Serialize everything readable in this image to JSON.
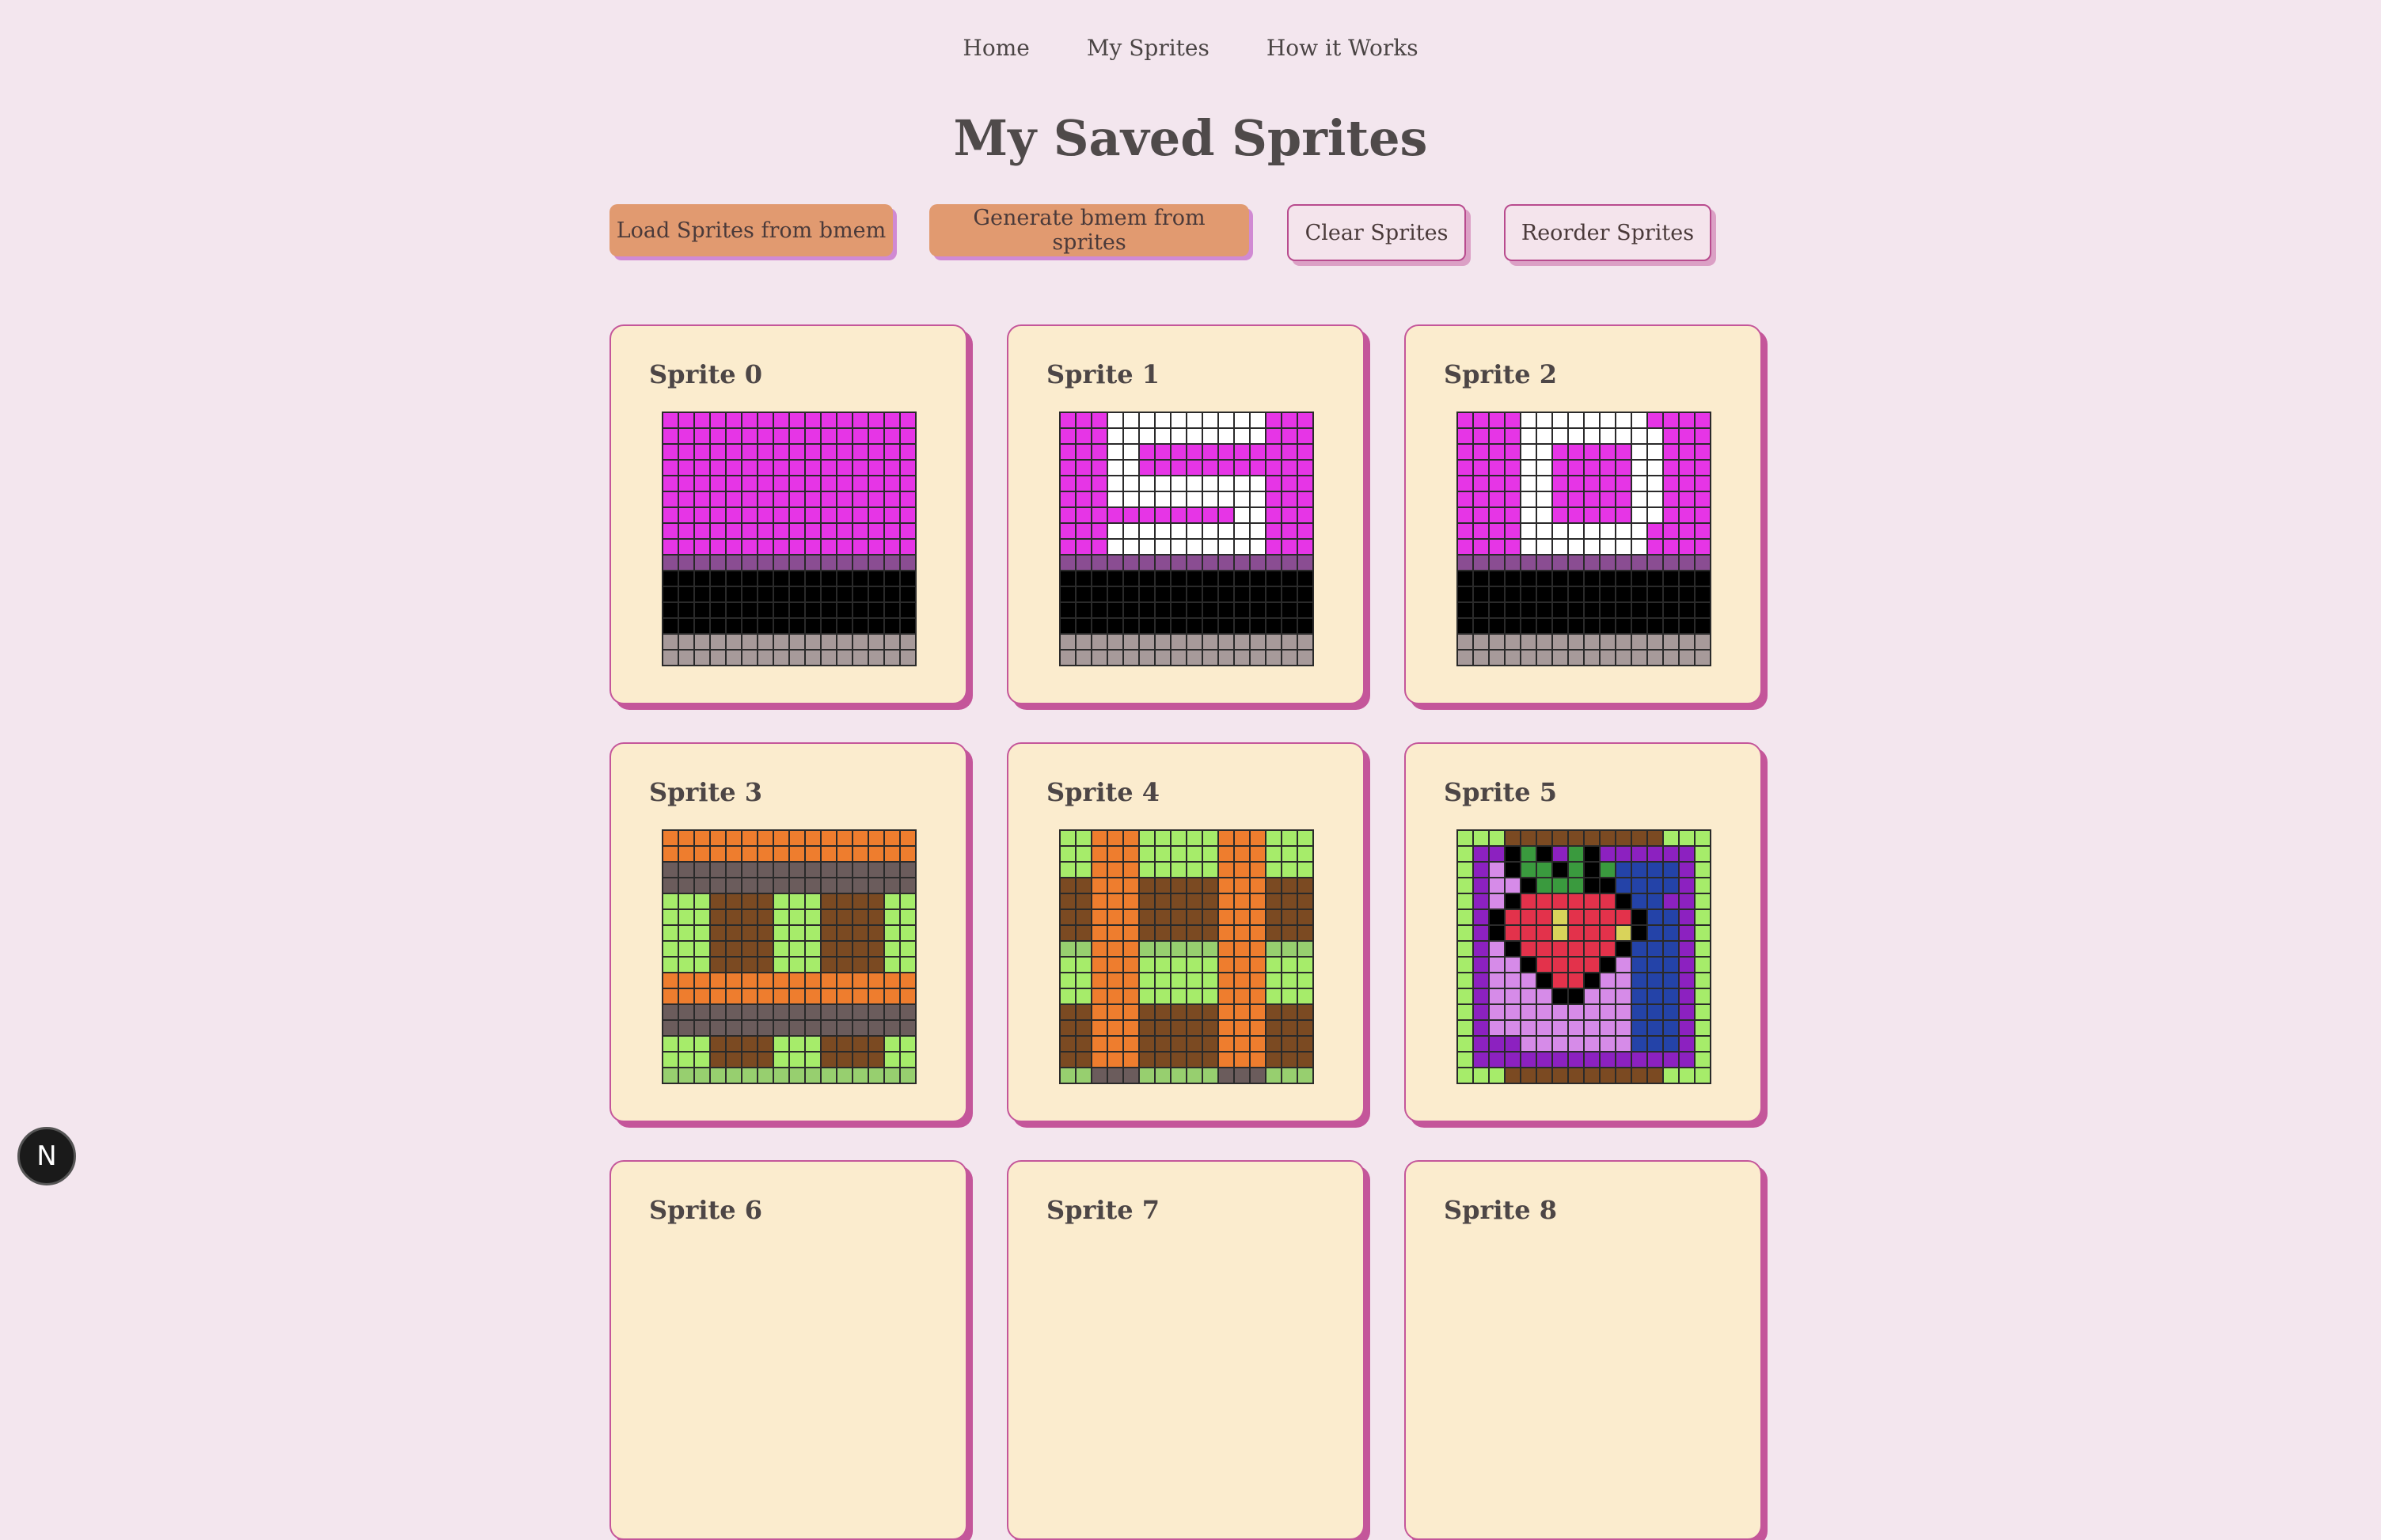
{
  "nav": {
    "home": "Home",
    "my_sprites": "My Sprites",
    "how_it_works": "How it Works"
  },
  "page_title": "My Saved Sprites",
  "buttons": {
    "load": "Load Sprites from bmem",
    "generate": "Generate bmem from sprites",
    "clear": "Clear Sprites",
    "reorder": "Reorder Sprites"
  },
  "badge": "N",
  "palette": {
    "M": "#e635e6",
    "W": "#ffffff",
    "P": "#8a4d92",
    "K": "#000000",
    "G": "#a79a9a",
    "O": "#ee7d2e",
    "D": "#6b5c5c",
    "B": "#7b4a22",
    "L": "#a6ec6a",
    "l": "#97cf6f",
    "V": "#8c21c0",
    "v": "#d68be8",
    "R": "#e3324b",
    "Y": "#d9d35a",
    "g": "#3a9a3e",
    "N": "#2443a8"
  },
  "sprites": [
    {
      "name": "Sprite 0",
      "rows": [
        "MMMMMMMMMMMMMMMM",
        "MMMMMMMMMMMMMMMM",
        "MMMMMMMMMMMMMMMM",
        "MMMMMMMMMMMMMMMM",
        "MMMMMMMMMMMMMMMM",
        "MMMMMMMMMMMMMMMM",
        "MMMMMMMMMMMMMMMM",
        "MMMMMMMMMMMMMMMM",
        "MMMMMMMMMMMMMMMM",
        "PPPPPPPPPPPPPPPP",
        "KKKKKKKKKKKKKKKK",
        "KKKKKKKKKKKKKKKK",
        "KKKKKKKKKKKKKKKK",
        "KKKKKKKKKKKKKKKK",
        "GGGGGGGGGGGGGGGG",
        "GGGGGGGGGGGGGGGG"
      ]
    },
    {
      "name": "Sprite 1",
      "rows": [
        "MMMWWWWWWWWWWMMM",
        "MMMWWWWWWWWWWMMM",
        "MMMWWMMMMMMMMMMM",
        "MMMWWMMMMMMMMMMM",
        "MMMWWWWWWWWWWMMM",
        "MMMWWWWWWWWWWMMM",
        "MMMMMMMMMMMWWMMM",
        "MMMWWWWWWWWWWMMM",
        "MMMWWWWWWWWWWMMM",
        "PPPPPPPPPPPPPPPP",
        "KKKKKKKKKKKKKKKK",
        "KKKKKKKKKKKKKKKK",
        "KKKKKKKKKKKKKKKK",
        "KKKKKKKKKKKKKKKK",
        "GGGGGGGGGGGGGGGG",
        "GGGGGGGGGGGGGGGG"
      ]
    },
    {
      "name": "Sprite 2",
      "rows": [
        "MMMMWWWWWWWWMMMM",
        "MMMMWWWWWWWWWMMM",
        "MMMMWWMMMMMWWMMM",
        "MMMMWWMMMMMWWMMM",
        "MMMMWWMMMMMWWMMM",
        "MMMMWWMMMMMWWMMM",
        "MMMMWWMMMMMWWMMM",
        "MMMMWWWWWWWWMMMM",
        "MMMMWWWWWWWWMMMM",
        "PPPPPPPPPPPPPPPP",
        "KKKKKKKKKKKKKKKK",
        "KKKKKKKKKKKKKKKK",
        "KKKKKKKKKKKKKKKK",
        "KKKKKKKKKKKKKKKK",
        "GGGGGGGGGGGGGGGG",
        "GGGGGGGGGGGGGGGG"
      ]
    },
    {
      "name": "Sprite 3",
      "rows": [
        "OOOOOOOOOOOOOOOO",
        "OOOOOOOOOOOOOOOO",
        "DDDDDDDDDDDDDDDD",
        "DDDDDDDDDDDDDDDD",
        "LLLBBBBLLLBBBBLL",
        "LLLBBBBLLLBBBBLL",
        "LLLBBBBLLLBBBBLL",
        "LLLBBBBLLLBBBBLL",
        "LLLBBBBLLLBBBBLL",
        "OOOOOOOOOOOOOOOO",
        "OOOOOOOOOOOOOOOO",
        "DDDDDDDDDDDDDDDD",
        "DDDDDDDDDDDDDDDD",
        "LLLBBBBLLLBBBBLL",
        "LLLBBBBLLLBBBBLL",
        "llllllllllllllll"
      ]
    },
    {
      "name": "Sprite 4",
      "rows": [
        "LLOOOLLLLLOOOLLL",
        "LLOOOLLLLLOOOLLL",
        "LLOOOLLLLLOOOLLL",
        "BBOOOBBBBBOOOBBB",
        "BBOOOBBBBBOOOBBB",
        "BBOOOBBBBBOOOBBB",
        "BBOOOBBBBBOOOBBB",
        "llOOOlllllOOOlll",
        "LLOOOLLLLLOOOLLL",
        "LLOOOLLLLLOOOLLL",
        "LLOOOLLLLLOOOLLL",
        "BBOOOBBBBBOOOBBB",
        "BBOOOBBBBBOOOBBB",
        "BBOOOBBBBBOOOBBB",
        "BBOOOBBBBBOOOBBB",
        "llDDDlllllDDDlll"
      ]
    },
    {
      "name": "Sprite 5",
      "rows": [
        "LLLBBBBBBBBBBLLL",
        "LVVKgKVgKVVVVVVL",
        "LVvKggKgKgNNNNVL",
        "LVvvKgggKKNNNNVL",
        "LVvKRRRRRRKNNVVL",
        "LVKRRRYRRRRKNNVL",
        "LVKRRRYRRRYKNNVL",
        "LVvKRRRRRRKNNNVL",
        "LVvvKRRRRKvNNNVL",
        "LVvvvKRRKvvNNNVL",
        "LVvvvvKKvvvNNNVL",
        "LVvvvvvvvvvNNNVL",
        "LVvvvvvvvvvNNNVL",
        "LVVVvvvvvvvNNNVL",
        "LVVVVVVVVVVVVVVL",
        "LLLBBBBBBBBBBLLL"
      ]
    },
    {
      "name": "Sprite 6",
      "rows": []
    },
    {
      "name": "Sprite 7",
      "rows": []
    },
    {
      "name": "Sprite 8",
      "rows": []
    }
  ]
}
